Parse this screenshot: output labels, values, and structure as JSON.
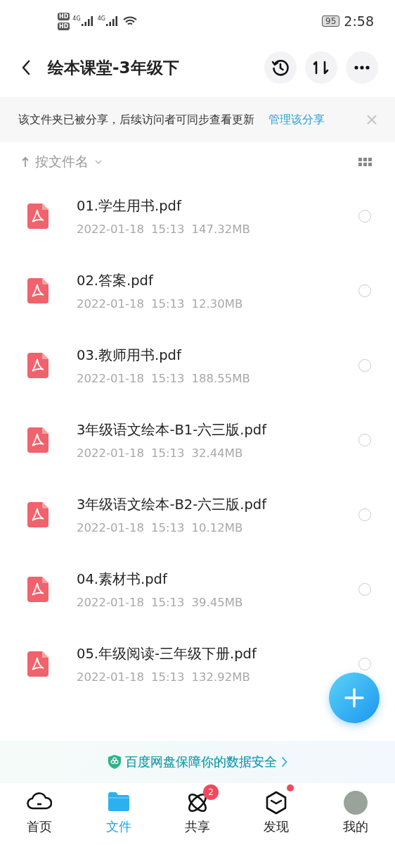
{
  "status_bar": {
    "battery": "95",
    "time": "2:58",
    "sim_labels": [
      "HD",
      "HD"
    ],
    "network_labels": [
      "4G",
      "4G"
    ]
  },
  "header": {
    "title": "绘本课堂-3年级下"
  },
  "share_notice": {
    "text": "该文件夹已被分享，后续访问者可同步查看更新",
    "link": "管理该分享"
  },
  "sort": {
    "label": "按文件名"
  },
  "files": [
    {
      "name": "01.学生用书.pdf",
      "date": "2022-01-18",
      "time": "15:13",
      "size": "147.32MB",
      "selected": false
    },
    {
      "name": "02.答案.pdf",
      "date": "2022-01-18",
      "time": "15:13",
      "size": "12.30MB",
      "selected": false
    },
    {
      "name": "03.教师用书.pdf",
      "date": "2022-01-18",
      "time": "15:13",
      "size": "188.55MB",
      "selected": false
    },
    {
      "name": "3年级语文绘本-B1-六三版.pdf",
      "date": "2022-01-18",
      "time": "15:13",
      "size": "32.44MB",
      "selected": false
    },
    {
      "name": "3年级语文绘本-B2-六三版.pdf",
      "date": "2022-01-18",
      "time": "15:13",
      "size": "10.12MB",
      "selected": false
    },
    {
      "name": "04.素材书.pdf",
      "date": "2022-01-18",
      "time": "15:13",
      "size": "39.45MB",
      "selected": false
    },
    {
      "name": "05.年级阅读-三年级下册.pdf",
      "date": "2022-01-18",
      "time": "15:13",
      "size": "132.92MB",
      "selected": false
    }
  ],
  "security_banner": {
    "text": "百度网盘保障你的数据安全"
  },
  "tabs": [
    {
      "label": "首页",
      "kind": "cloud",
      "selected": false
    },
    {
      "label": "文件",
      "kind": "folder",
      "selected": true
    },
    {
      "label": "共享",
      "kind": "atom",
      "selected": false,
      "badge": "2"
    },
    {
      "label": "发现",
      "kind": "discover",
      "selected": false,
      "dot": true
    },
    {
      "label": "我的",
      "kind": "avatar",
      "selected": false
    }
  ]
}
